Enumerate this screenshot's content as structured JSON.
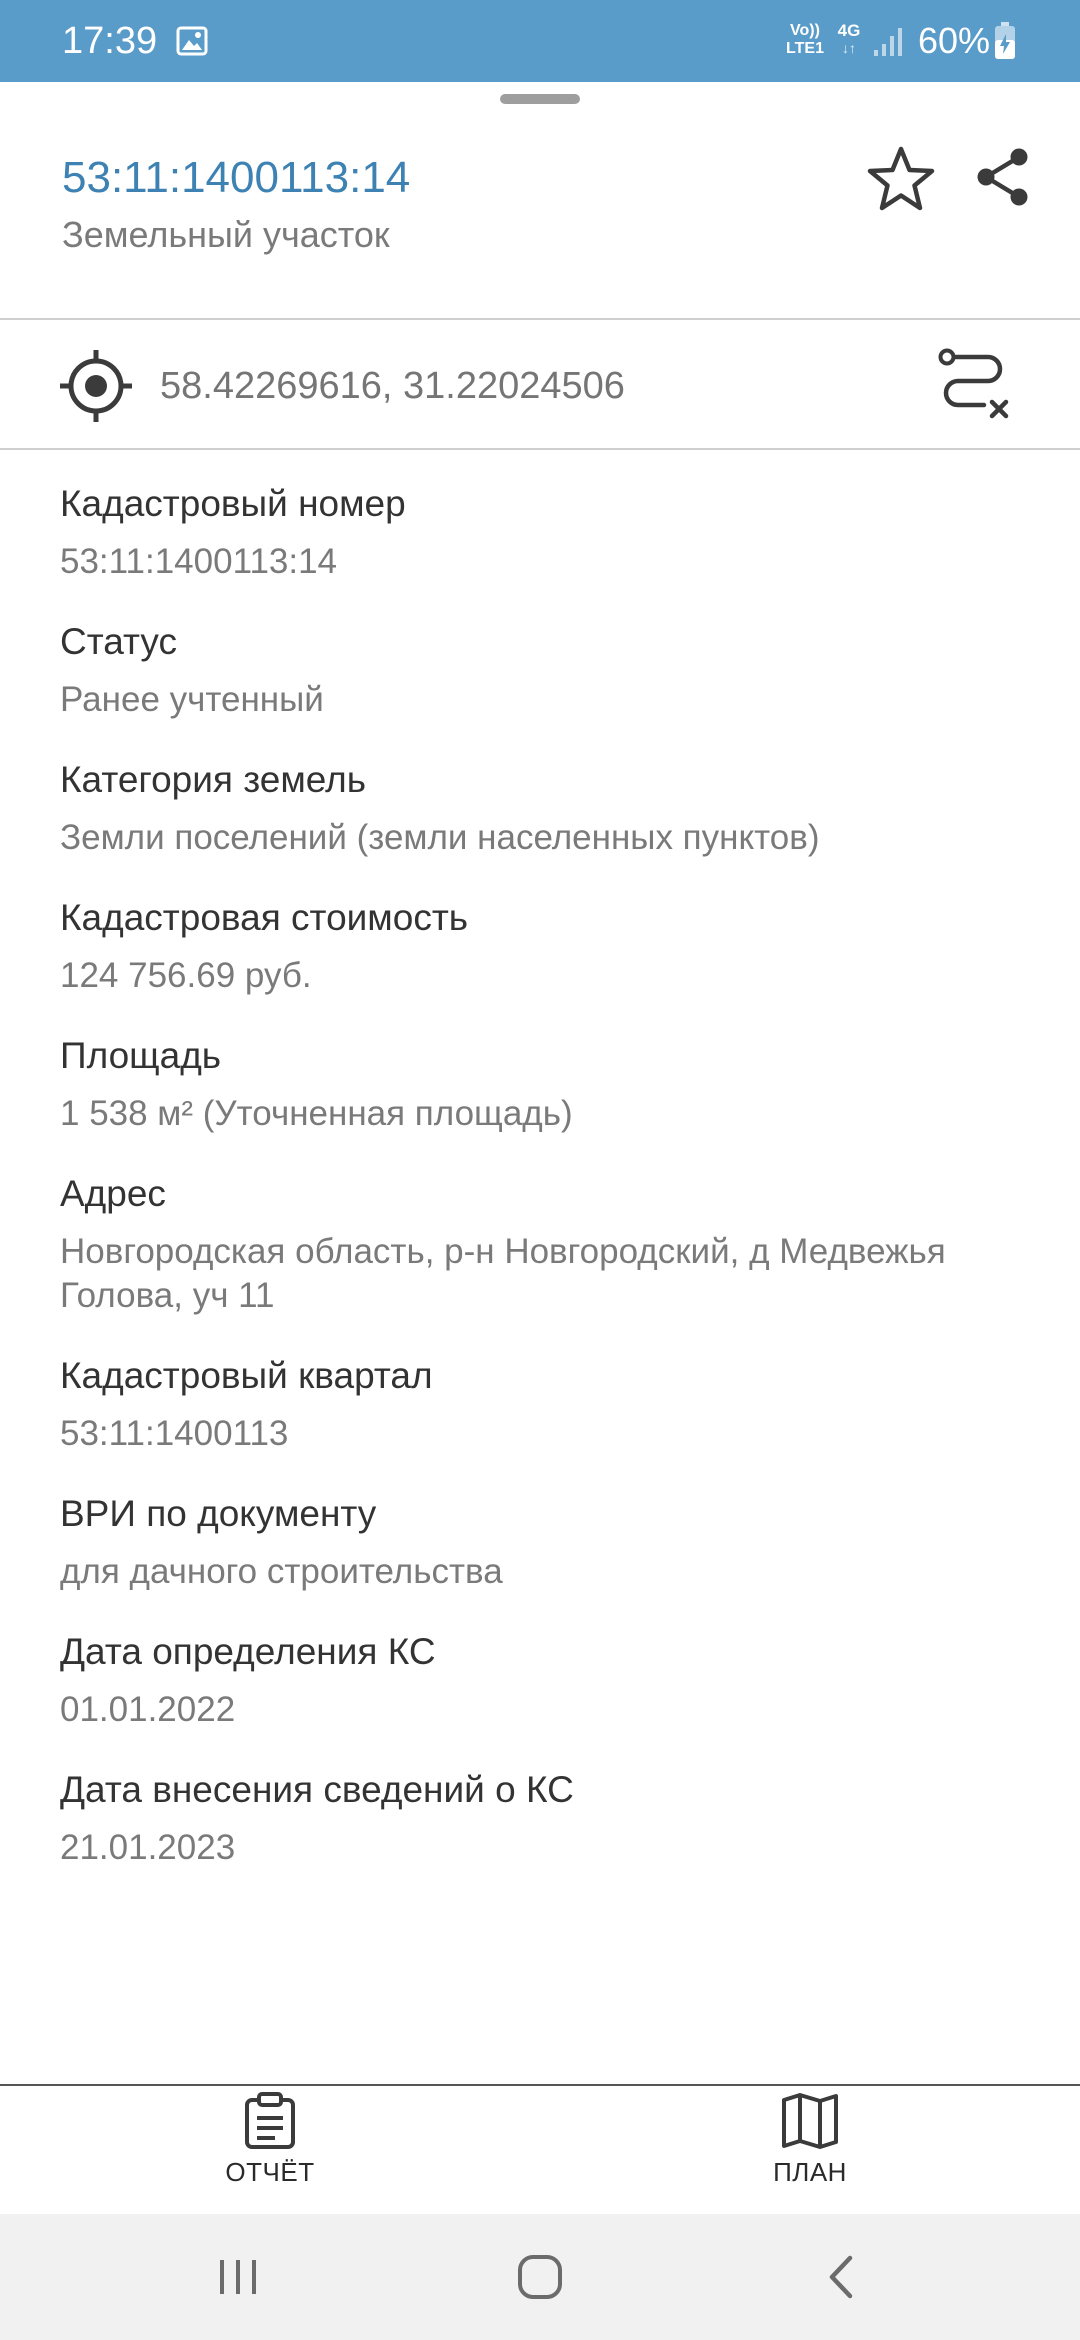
{
  "status_bar": {
    "time": "17:39",
    "volte_line1": "Vo))",
    "volte_line2": "LTE1",
    "network": "4G",
    "battery": "60%",
    "background": "#5a9cc9",
    "icons": [
      "image-icon",
      "signal-icon",
      "battery-charging-icon"
    ]
  },
  "header": {
    "title": "53:11:1400113:14",
    "subtitle": "Земельный участок",
    "title_color": "#3d82b3",
    "actions": [
      "star-icon",
      "share-icon"
    ]
  },
  "coordinates": {
    "text": "58.42269616, 31.22024506",
    "left_icon": "target-icon",
    "right_icon": "route-off-icon"
  },
  "fields": [
    {
      "label": "Кадастровый номер",
      "value": "53:11:1400113:14"
    },
    {
      "label": "Статус",
      "value": "Ранее учтенный"
    },
    {
      "label": "Категория земель",
      "value": "Земли поселений (земли населенных пунктов)"
    },
    {
      "label": "Кадастровая стоимость",
      "value": "124 756.69 руб."
    },
    {
      "label": "Площадь",
      "value": "1 538 м² (Уточненная площадь)"
    },
    {
      "label": "Адрес",
      "value": "Новгородская область, р-н Новгородский, д Медвежья Голова, уч 11"
    },
    {
      "label": "Кадастровый квартал",
      "value": "53:11:1400113"
    },
    {
      "label": "ВРИ по документу",
      "value": "для дачного строительства"
    },
    {
      "label": "Дата определения КС",
      "value": "01.01.2022"
    },
    {
      "label": "Дата внесения сведений о КС",
      "value": "21.01.2023"
    }
  ],
  "bottom_actions": {
    "report": {
      "label": "ОТЧЁТ",
      "icon": "clipboard-icon"
    },
    "plan": {
      "label": "ПЛАН",
      "icon": "map-icon"
    }
  },
  "nav_bar": {
    "buttons": [
      "recent-apps-icon",
      "home-icon",
      "back-icon"
    ]
  }
}
